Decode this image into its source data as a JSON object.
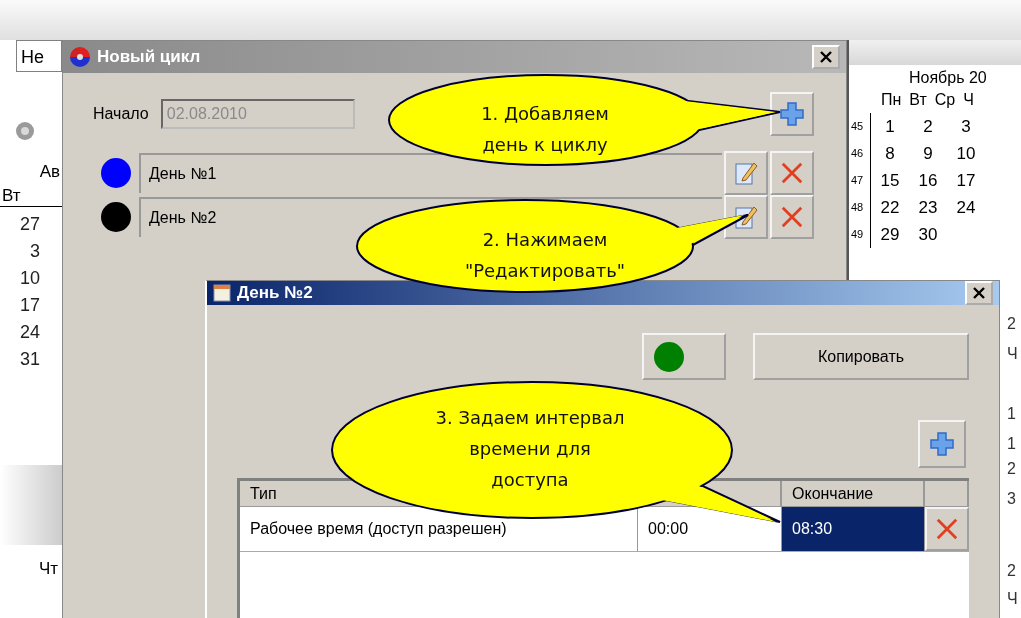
{
  "background": {
    "left_field": "He",
    "left_calendar": {
      "month": "Ав",
      "weekday": "Вт",
      "days": [
        "27",
        "3",
        "10",
        "17",
        "24",
        "31"
      ],
      "bottom_weekday": "Чт"
    },
    "right_calendar": {
      "month": "Ноябрь 20",
      "weekdays": [
        "Пн",
        "Вт",
        "Ср",
        "Ч"
      ],
      "weeks": [
        {
          "number": "45",
          "days": [
            "1",
            "2",
            "3"
          ]
        },
        {
          "number": "46",
          "days": [
            "8",
            "9",
            "10"
          ]
        },
        {
          "number": "47",
          "days": [
            "15",
            "16",
            "17"
          ]
        },
        {
          "number": "48",
          "days": [
            "22",
            "23",
            "24"
          ]
        },
        {
          "number": "49",
          "days": [
            "29",
            "30"
          ]
        }
      ]
    },
    "right_fragments": [
      "2",
      "Ч",
      "1",
      "1",
      "2",
      "3",
      "2",
      "Ч"
    ]
  },
  "cycle_window": {
    "title": "Новый цикл",
    "start_label": "Начало",
    "start_value": "02.08.2010",
    "days": [
      {
        "name": "День №1",
        "color": "#0000ff"
      },
      {
        "name": "День №2",
        "color": "#000000"
      }
    ]
  },
  "day_window": {
    "title": "День №2",
    "color": "#008000",
    "copy_button": "Копировать",
    "table": {
      "type_header": "Тип",
      "end_header": "Окончание",
      "rows": [
        {
          "type": "Рабочее время (доступ разрешен)",
          "start": "00:00",
          "end": "08:30",
          "end_selected": true
        }
      ]
    }
  },
  "callouts": [
    {
      "lines": [
        "1. Добавляем",
        "день к циклу"
      ]
    },
    {
      "lines": [
        "2. Нажимаем",
        "\"Редактировать\""
      ]
    },
    {
      "lines": [
        "3. Задаем интервал",
        "времени для",
        "доступа"
      ]
    }
  ]
}
